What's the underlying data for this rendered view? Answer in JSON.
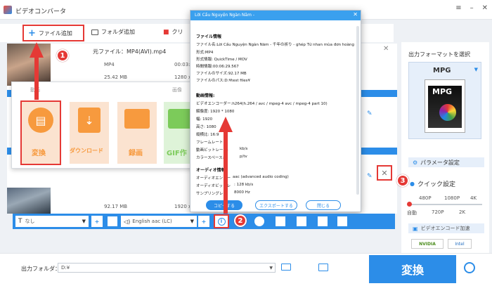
{
  "app": {
    "title": "ビデオコンバータ"
  },
  "toolbar": {
    "add_file": "ファイル追加",
    "add_folder": "フォルダ追加",
    "clear": "クリ"
  },
  "file": {
    "name": "元ファイル：MP4(AVI).mp4",
    "format": "MP4",
    "duration": "00:03:3",
    "size": "25.42 MB",
    "resolution": "1280 x",
    "size2": "92.17 MB",
    "resolution2": "1920 x"
  },
  "menu": {
    "tab1": "動画",
    "tab2": "画像",
    "convert": "変換",
    "download": "ダウンロード",
    "record": "録画",
    "gif": "GIF作"
  },
  "dialog": {
    "title": "Lời Cầu Nguyện Ngàn Năm -",
    "sec1": "ファイル情報",
    "filename": "ファイル名:Lời Cầu Nguyện Ngàn Năm - 千年の祈り - ghép Từ nhan mùa đơn hoàng phi thiên (Ziyan s",
    "format": "形式:MP4",
    "fmtinfo": "形式情報: QuickTime / MOV",
    "time": "時間情報:00:06:29.567",
    "fsize": "ファイルのサイズ:92.17 MB",
    "path": "ファイルのパス:D:¥test files¥",
    "sec2": "動画情報:",
    "vcodec": "ビデオエンコーダー:h264(h.264 / avc / mpeg-4 avc / mpeg-4 part 10)",
    "res": "解像度: 1920 * 1080",
    "width": "幅: 1920",
    "height": "高さ: 1080",
    "aspect": "縦横比: 16:9",
    "framerate": "フレームレート:",
    "vbitrate": "動画ビットレート:",
    "colorspace": "カラースペース:",
    "vb_tail": "kb/s",
    "cs_tail": "p/tv",
    "sec3": "オーディオ情報:",
    "acodec": "オーディオエンコー",
    "acodec_tail": "aac (advanced audio coding)",
    "abitrate": "オーディオビットレ",
    "abitrate_tail": ": 128 kb/s",
    "sample": "サンプリングレー",
    "sample_tail": "8000 Hz",
    "copy": "コピーする",
    "export": "エクスポートする",
    "close": "閉じる"
  },
  "edit": {
    "subtitle": "なし",
    "audio": "English aac (LC)"
  },
  "right": {
    "output_title": "出力フォーマットを選択",
    "format": "MPG",
    "format_icon_label": "MPG",
    "param": "パラメータ設定",
    "quick": "クイック設定",
    "q480": "480P",
    "q1080": "1080P",
    "q4k": "4K",
    "qauto": "自動",
    "q720": "720P",
    "q2k": "2K",
    "hw": "ビデオエンコード加速",
    "nvidia": "NVIDIA",
    "intel": "Intel"
  },
  "bottom": {
    "folder_label": "出力フォルダ：",
    "folder_value": "D:¥",
    "convert": "変換"
  },
  "badges": [
    "1",
    "2",
    "3"
  ],
  "colors": {
    "accent": "#2c8de8",
    "marker": "#e53935",
    "tile": "#f79a3e"
  }
}
